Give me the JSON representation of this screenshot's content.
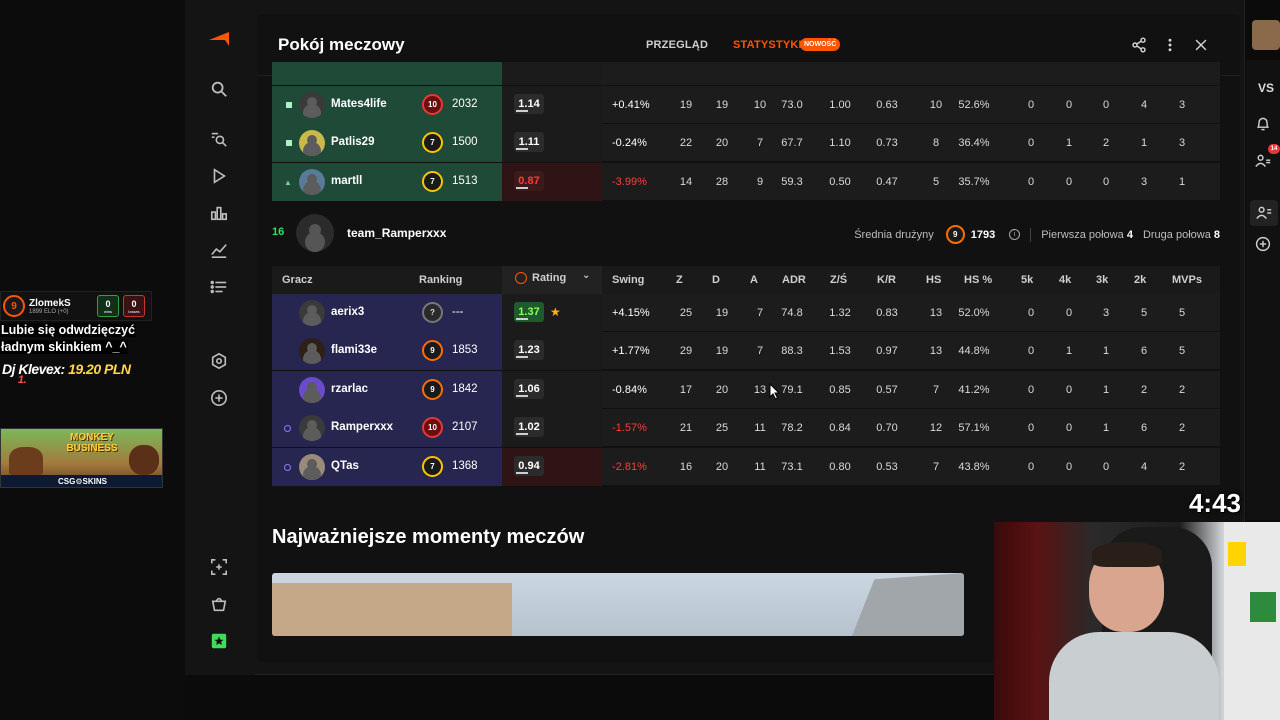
{
  "overlay": {
    "elo_widget": {
      "level": "9",
      "name": "ZlomekS",
      "sub": "1899 ELO (+0)",
      "wins": "0",
      "wins_label": "wins",
      "losses": "0",
      "losses_label": "losses"
    },
    "donation_message_line1": "Lubie się odwdzięczyć",
    "donation_message_line2": "ładnym skinkiem ^_^",
    "top_donor": {
      "rank": "1.",
      "name": "Dj Klevex:",
      "amount": "19.20 PLN"
    },
    "promo": {
      "title_line1": "MONKEY",
      "title_line2": "BUSINESS",
      "sponsor": "CSG⚙SKINS"
    },
    "timer": "4:43"
  },
  "modal": {
    "title": "Pokój meczowy",
    "tabs": [
      {
        "label": "PRZEGLĄD",
        "active": false
      },
      {
        "label": "STATYSTYKI",
        "active": true
      }
    ],
    "new_badge": "NOWOŚĆ"
  },
  "team1_rows": [
    {
      "name": "Mates4life",
      "level": "10",
      "elo": "2032",
      "rating": "1.14",
      "swing": "+0.41%",
      "k": "19",
      "d": "19",
      "a": "10",
      "adr": "73.0",
      "kd": "1.00",
      "kr": "0.63",
      "hs": "10",
      "hsp": "52.6%",
      "k5": "0",
      "k4": "0",
      "k3": "0",
      "k2": "4",
      "mvps": "3",
      "marker": "square"
    },
    {
      "name": "Patlis29",
      "level": "7",
      "elo": "1500",
      "rating": "1.11",
      "swing": "-0.24%",
      "k": "22",
      "d": "20",
      "a": "7",
      "adr": "67.7",
      "kd": "1.10",
      "kr": "0.73",
      "hs": "8",
      "hsp": "36.4%",
      "k5": "0",
      "k4": "1",
      "k3": "2",
      "k2": "1",
      "mvps": "3",
      "marker": "square"
    },
    {
      "name": "martll",
      "level": "7",
      "elo": "1513",
      "rating": "0.87",
      "swing": "-3.99%",
      "k": "14",
      "d": "28",
      "a": "9",
      "adr": "59.3",
      "kd": "0.50",
      "kr": "0.47",
      "hs": "5",
      "hsp": "35.7%",
      "k5": "0",
      "k4": "0",
      "k3": "0",
      "k2": "3",
      "mvps": "1",
      "marker": "triangle"
    }
  ],
  "team2": {
    "rank": "16",
    "name": "team_Ramperxxx",
    "avg_label": "Średnia drużyny",
    "avg_level": "9",
    "avg_elo": "1793",
    "first_half_label": "Pierwsza połowa",
    "first_half": "4",
    "second_half_label": "Druga połowa",
    "second_half": "8"
  },
  "columns": {
    "player": "Gracz",
    "ranking": "Ranking",
    "rating": "Rating",
    "swing": "Swing",
    "k": "Z",
    "d": "D",
    "a": "A",
    "adr": "ADR",
    "kd": "Z/Ś",
    "kr": "K/R",
    "hs": "HS",
    "hsp": "HS %",
    "k5": "5k",
    "k4": "4k",
    "k3": "3k",
    "k2": "2k",
    "mvps": "MVPs"
  },
  "team2_rows": [
    {
      "name": "aerix3",
      "level": "?",
      "elo": "---",
      "rating": "1.37",
      "swing": "+4.15%",
      "k": "25",
      "d": "19",
      "a": "7",
      "adr": "74.8",
      "kd": "1.32",
      "kr": "0.83",
      "hs": "13",
      "hsp": "52.0%",
      "k5": "0",
      "k4": "0",
      "k3": "3",
      "k2": "5",
      "mvps": "5"
    },
    {
      "name": "flami33e",
      "level": "9",
      "elo": "1853",
      "rating": "1.23",
      "swing": "+1.77%",
      "k": "29",
      "d": "19",
      "a": "7",
      "adr": "88.3",
      "kd": "1.53",
      "kr": "0.97",
      "hs": "13",
      "hsp": "44.8%",
      "k5": "0",
      "k4": "1",
      "k3": "1",
      "k2": "6",
      "mvps": "5"
    },
    {
      "name": "rzarlac",
      "level": "9",
      "elo": "1842",
      "rating": "1.06",
      "swing": "-0.84%",
      "k": "17",
      "d": "20",
      "a": "13",
      "adr": "79.1",
      "kd": "0.85",
      "kr": "0.57",
      "hs": "7",
      "hsp": "41.2%",
      "k5": "0",
      "k4": "0",
      "k3": "1",
      "k2": "2",
      "mvps": "2"
    },
    {
      "name": "Ramperxxx",
      "level": "10",
      "elo": "2107",
      "rating": "1.02",
      "swing": "-1.57%",
      "k": "21",
      "d": "25",
      "a": "11",
      "adr": "78.2",
      "kd": "0.84",
      "kr": "0.70",
      "hs": "12",
      "hsp": "57.1%",
      "k5": "0",
      "k4": "0",
      "k3": "1",
      "k2": "6",
      "mvps": "2"
    },
    {
      "name": "QTas",
      "level": "7",
      "elo": "1368",
      "rating": "0.94",
      "swing": "-2.81%",
      "k": "16",
      "d": "20",
      "a": "11",
      "adr": "73.1",
      "kd": "0.80",
      "kr": "0.53",
      "hs": "7",
      "hsp": "43.8%",
      "k5": "0",
      "k4": "0",
      "k3": "0",
      "k2": "4",
      "mvps": "2"
    }
  ],
  "highlights_title": "Najważniejsze momenty meczów",
  "rightbar": {
    "vs_label": "VS",
    "notification_count": "14"
  }
}
